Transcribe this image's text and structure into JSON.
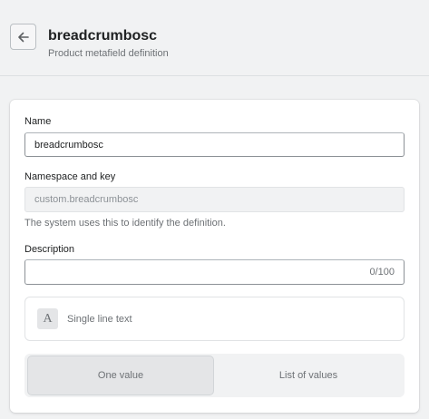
{
  "header": {
    "title": "breadcrumbosc",
    "subtitle": "Product metafield definition",
    "back_icon": "arrow-left-icon"
  },
  "form": {
    "name": {
      "label": "Name",
      "value": "breadcrumbosc"
    },
    "namespace_key": {
      "label": "Namespace and key",
      "value": "custom.breadcrumbosc",
      "help": "The system uses this to identify the definition."
    },
    "description": {
      "label": "Description",
      "value": "",
      "counter": "0/100"
    },
    "type": {
      "icon_letter": "A",
      "label": "Single line text"
    },
    "value_options": [
      {
        "label": "One value",
        "selected": true
      },
      {
        "label": "List of values",
        "selected": false
      }
    ]
  }
}
